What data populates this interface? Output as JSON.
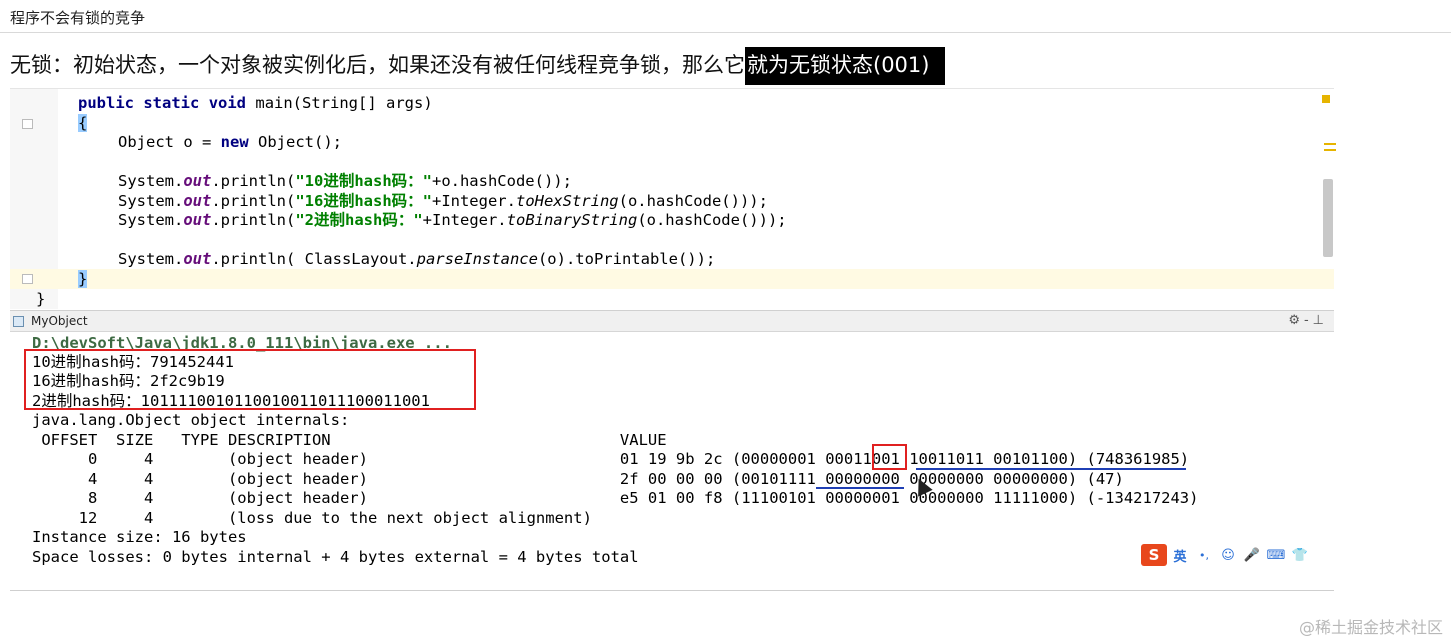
{
  "header": {
    "title": "程序不会有锁的竞争"
  },
  "intro": {
    "text": "无锁：初始状态，一个对象被实例化后，如果还没有被任何线程竞争锁，那么它",
    "highlight": "就为无锁状态(001)"
  },
  "editor": {
    "line1": {
      "kw1": "public",
      "kw2": "static",
      "kw3": "void",
      "rest": "main(String[] args)"
    },
    "line2": {
      "brace": "{"
    },
    "line3": {
      "a": "Object o = ",
      "kw": "new",
      "b": "Object();"
    },
    "line4": {
      "a": "System.",
      "fld": "out",
      "b": ".println(",
      "str": "\"10进制hash码：\"",
      "c": "+o.hashCode());"
    },
    "line5": {
      "a": "System.",
      "fld": "out",
      "b": ".println(",
      "str": "\"16进制hash码：\"",
      "c": "+Integer.",
      "m": "toHexString",
      "d": "(o.hashCode()));"
    },
    "line6": {
      "a": "System.",
      "fld": "out",
      "b": ".println(",
      "str": "\"2进制hash码：\"",
      "c": "+Integer.",
      "m": "toBinaryString",
      "d": "(o.hashCode()));"
    },
    "line7": {
      "a": "System.",
      "fld": "out",
      "b": ".println( ClassLayout.",
      "m": "parseInstance",
      "d": "(o).toPrintable());"
    },
    "line8": {
      "brace": "}"
    },
    "line9": {
      "brace": "}"
    }
  },
  "console_bar": {
    "tab": "MyObject",
    "tools": "⚙-⊥"
  },
  "console": {
    "cmd": "D:\\devSoft\\Java\\jdk1.8.0_111\\bin\\java.exe ...",
    "lines": [
      "10进制hash码：791452441",
      "16进制hash码：2f2c9b19",
      "2进制hash码：1011110010110010011011100011001",
      "java.lang.Object object internals:",
      " OFFSET  SIZE   TYPE DESCRIPTION                               VALUE",
      "      0     4        (object header)                           01 19 9b 2c (00000001 00011001 10011011 00101100) (748361985)",
      "      4     4        (object header)                           2f 00 00 00 (00101111 00000000 00000000 00000000) (47)",
      "      8     4        (object header)                           e5 01 00 f8 (11100101 00000001 00000000 11111000) (-134217243)",
      "     12     4        (loss due to the next object alignment)",
      "Instance size: 16 bytes",
      "Space losses: 0 bytes internal + 4 bytes external = 4 bytes total"
    ]
  },
  "ime": {
    "logo": "S",
    "lang": "英",
    "punct": "•,",
    "icons": [
      "☺",
      "🎤",
      "⌨",
      "👕"
    ]
  },
  "watermark": "@稀土掘金技术社区",
  "colors": {
    "red_box": "#e02020",
    "underline": "#1f3fb5",
    "highlight_bg": "#000000"
  }
}
